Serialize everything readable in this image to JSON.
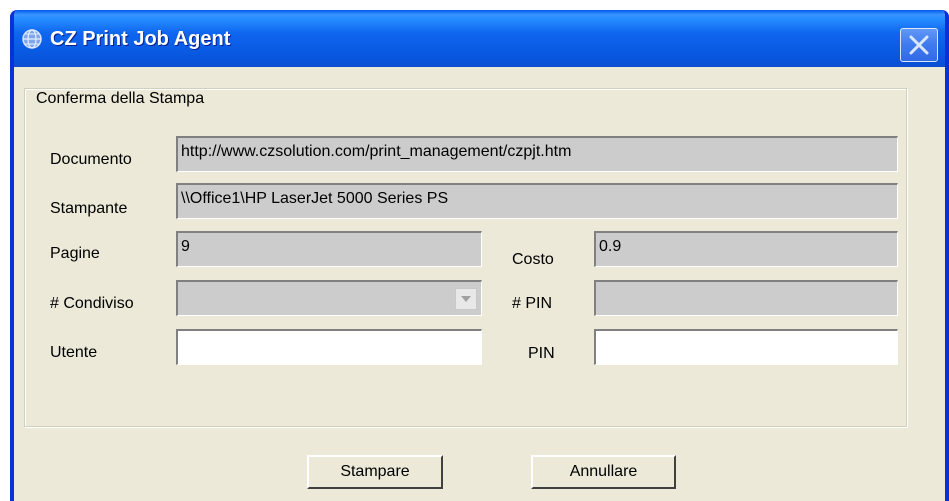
{
  "window": {
    "title": "CZ Print Job Agent",
    "app_icon": "globe-icon",
    "close_icon": "close-icon"
  },
  "group": {
    "legend": "Conferma della Stampa"
  },
  "fields": {
    "documento": {
      "label": "Documento",
      "value": "http://www.czsolution.com/print_management/czpjt.htm"
    },
    "stampante": {
      "label": "Stampante",
      "value": "\\\\Office1\\HP LaserJet 5000 Series PS"
    },
    "pagine": {
      "label": "Pagine",
      "value": "9"
    },
    "costo": {
      "label": "Costo",
      "value": "0.9"
    },
    "condiviso": {
      "label": "# Condiviso",
      "value": ""
    },
    "num_pin": {
      "label": "# PIN",
      "value": ""
    },
    "utente": {
      "label": "Utente",
      "value": ""
    },
    "pin": {
      "label": "PIN",
      "value": ""
    }
  },
  "buttons": {
    "print": "Stampare",
    "cancel": "Annullare"
  }
}
